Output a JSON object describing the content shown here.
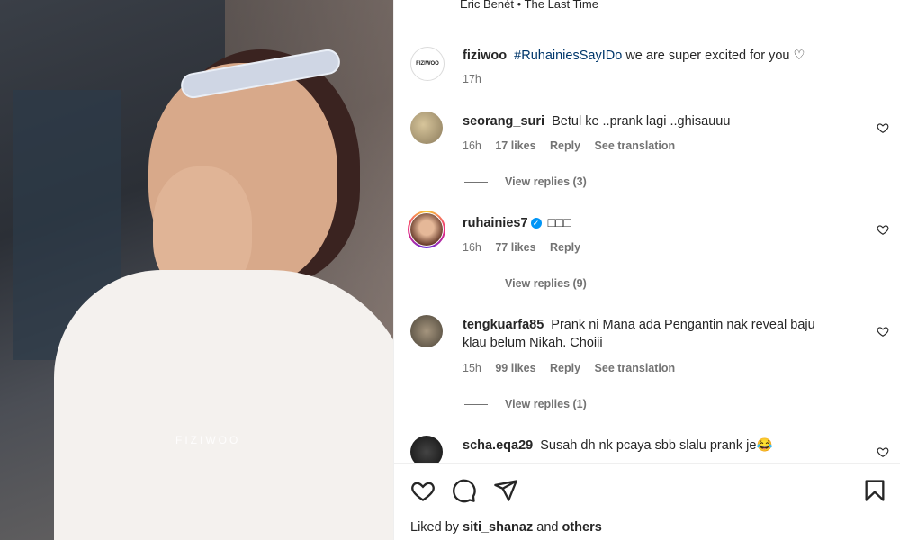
{
  "music": {
    "artist": "Eric Benét",
    "separator": "•",
    "song": "The Last Time"
  },
  "media": {
    "watermark": "FIZIWOO"
  },
  "caption": {
    "avatar_text": "FIZIWOO",
    "username": "fiziwoo",
    "hashtag": "#RuhainiesSayIDo",
    "text": "we are super excited for you ♡",
    "time": "17h"
  },
  "comments": [
    {
      "username": "seorang_suri",
      "text": "Betul ke ..prank lagi ..ghisauuu",
      "time": "16h",
      "likes": "17 likes",
      "reply": "Reply",
      "translate": "See translation",
      "view_replies": "View replies (3)"
    },
    {
      "username": "ruhainies7",
      "verified": "✓",
      "text": "□□□",
      "time": "16h",
      "likes": "77 likes",
      "reply": "Reply",
      "view_replies": "View replies (9)"
    },
    {
      "username": "tengkuarfa85",
      "text": "Prank ni Mana ada Pengantin nak reveal baju klau belum Nikah. Choiii",
      "time": "15h",
      "likes": "99 likes",
      "reply": "Reply",
      "translate": "See translation",
      "view_replies": "View replies (1)"
    },
    {
      "username": "scha.eqa29",
      "text": "Susah dh nk pcaya sbb slalu prank je😂"
    }
  ],
  "actions": {
    "like_icon": "heart-icon",
    "comment_icon": "comment-icon",
    "share_icon": "send-icon",
    "save_icon": "bookmark-icon"
  },
  "liked_by": {
    "prefix": "Liked by",
    "user": "siti_shanaz",
    "and": "and",
    "others": "others"
  }
}
